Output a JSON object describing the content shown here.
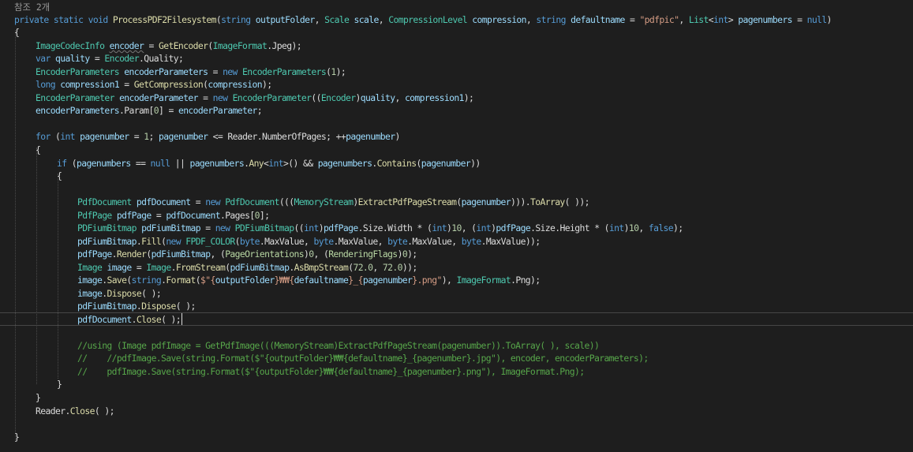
{
  "codelens": "참조 2개",
  "colors": {
    "background": "#1e1e1e",
    "default": "#dcdcdc",
    "keyword": "#569cd6",
    "type": "#4ec9b0",
    "enum": "#b8d7a3",
    "method": "#dcdcaa",
    "parameter": "#9cdcfe",
    "string": "#d69d85",
    "number": "#b5cea8",
    "comment": "#57a64a"
  },
  "lines": [
    [
      [
        "kw",
        "private"
      ],
      [
        "de",
        " "
      ],
      [
        "kw",
        "static"
      ],
      [
        "de",
        " "
      ],
      [
        "kw",
        "void"
      ],
      [
        "de",
        " "
      ],
      [
        "me",
        "ProcessPDF2Filesystem"
      ],
      [
        "de",
        "("
      ],
      [
        "kw",
        "string"
      ],
      [
        "de",
        " "
      ],
      [
        "pa",
        "outputFolder"
      ],
      [
        "de",
        ", "
      ],
      [
        "ty",
        "Scale"
      ],
      [
        "de",
        " "
      ],
      [
        "pa",
        "scale"
      ],
      [
        "de",
        ", "
      ],
      [
        "ty",
        "CompressionLevel"
      ],
      [
        "de",
        " "
      ],
      [
        "pa",
        "compression"
      ],
      [
        "de",
        ", "
      ],
      [
        "kw",
        "string"
      ],
      [
        "de",
        " "
      ],
      [
        "pa",
        "defaultname"
      ],
      [
        "de",
        " = "
      ],
      [
        "st",
        "\"pdfpic\""
      ],
      [
        "de",
        ", "
      ],
      [
        "ty",
        "List"
      ],
      [
        "de",
        "<"
      ],
      [
        "kw",
        "int"
      ],
      [
        "de",
        "> "
      ],
      [
        "pa",
        "pagenumbers"
      ],
      [
        "de",
        " = "
      ],
      [
        "kw",
        "null"
      ],
      [
        "de",
        ")"
      ]
    ],
    [
      [
        "de",
        "{"
      ]
    ],
    [
      [
        "ty",
        "ImageCodecInfo"
      ],
      [
        "de",
        " "
      ],
      [
        "lo",
        "encoder"
      ],
      [
        "de",
        " = "
      ],
      [
        "me",
        "GetEncoder"
      ],
      [
        "de",
        "("
      ],
      [
        "ty",
        "ImageFormat"
      ],
      [
        "de",
        "."
      ],
      [
        "pr",
        "Jpeg"
      ],
      [
        "de",
        ");"
      ]
    ],
    [
      [
        "kw",
        "var"
      ],
      [
        "de",
        " "
      ],
      [
        "lo",
        "quality"
      ],
      [
        "de",
        " = "
      ],
      [
        "ty",
        "Encoder"
      ],
      [
        "de",
        "."
      ],
      [
        "pr",
        "Quality"
      ],
      [
        "de",
        ";"
      ]
    ],
    [
      [
        "ty",
        "EncoderParameters"
      ],
      [
        "de",
        " "
      ],
      [
        "lo",
        "encoderParameters"
      ],
      [
        "de",
        " = "
      ],
      [
        "kw",
        "new"
      ],
      [
        "de",
        " "
      ],
      [
        "ty",
        "EncoderParameters"
      ],
      [
        "de",
        "("
      ],
      [
        "nu",
        "1"
      ],
      [
        "de",
        ");"
      ]
    ],
    [
      [
        "kw",
        "long"
      ],
      [
        "de",
        " "
      ],
      [
        "lo",
        "compression1"
      ],
      [
        "de",
        " = "
      ],
      [
        "me",
        "GetCompression"
      ],
      [
        "de",
        "("
      ],
      [
        "pa",
        "compression"
      ],
      [
        "de",
        ");"
      ]
    ],
    [
      [
        "ty",
        "EncoderParameter"
      ],
      [
        "de",
        " "
      ],
      [
        "lo",
        "encoderParameter"
      ],
      [
        "de",
        " = "
      ],
      [
        "kw",
        "new"
      ],
      [
        "de",
        " "
      ],
      [
        "ty",
        "EncoderParameter"
      ],
      [
        "de",
        "(("
      ],
      [
        "ty",
        "Encoder"
      ],
      [
        "de",
        ")"
      ],
      [
        "lo",
        "quality"
      ],
      [
        "de",
        ", "
      ],
      [
        "lo",
        "compression1"
      ],
      [
        "de",
        ");"
      ]
    ],
    [
      [
        "lo",
        "encoderParameters"
      ],
      [
        "de",
        "."
      ],
      [
        "pr",
        "Param"
      ],
      [
        "de",
        "["
      ],
      [
        "nu",
        "0"
      ],
      [
        "de",
        "] = "
      ],
      [
        "lo",
        "encoderParameter"
      ],
      [
        "de",
        ";"
      ]
    ],
    [
      [
        "kw",
        "for"
      ],
      [
        "de",
        " ("
      ],
      [
        "kw",
        "int"
      ],
      [
        "de",
        " "
      ],
      [
        "lo",
        "pagenumber"
      ],
      [
        "de",
        " = "
      ],
      [
        "nu",
        "1"
      ],
      [
        "de",
        "; "
      ],
      [
        "lo",
        "pagenumber"
      ],
      [
        "de",
        " <= "
      ],
      [
        "pr",
        "Reader"
      ],
      [
        "de",
        "."
      ],
      [
        "pr",
        "NumberOfPages"
      ],
      [
        "de",
        "; ++"
      ],
      [
        "lo",
        "pagenumber"
      ],
      [
        "de",
        ")"
      ]
    ],
    [
      [
        "de",
        "{"
      ]
    ],
    [
      [
        "kw",
        "if"
      ],
      [
        "de",
        " ("
      ],
      [
        "pa",
        "pagenumbers"
      ],
      [
        "de",
        " == "
      ],
      [
        "kw",
        "null"
      ],
      [
        "de",
        " || "
      ],
      [
        "pa",
        "pagenumbers"
      ],
      [
        "de",
        "."
      ],
      [
        "me",
        "Any"
      ],
      [
        "de",
        "<"
      ],
      [
        "kw",
        "int"
      ],
      [
        "de",
        ">() && "
      ],
      [
        "pa",
        "pagenumbers"
      ],
      [
        "de",
        "."
      ],
      [
        "me",
        "Contains"
      ],
      [
        "de",
        "("
      ],
      [
        "lo",
        "pagenumber"
      ],
      [
        "de",
        "))"
      ]
    ],
    [
      [
        "de",
        "{"
      ]
    ],
    [
      [
        "ty",
        "PdfDocument"
      ],
      [
        "de",
        " "
      ],
      [
        "lo",
        "pdfDocument"
      ],
      [
        "de",
        " = "
      ],
      [
        "kw",
        "new"
      ],
      [
        "de",
        " "
      ],
      [
        "ty",
        "PdfDocument"
      ],
      [
        "de",
        "((("
      ],
      [
        "ty",
        "MemoryStream"
      ],
      [
        "de",
        ")"
      ],
      [
        "me",
        "ExtractPdfPageStream"
      ],
      [
        "de",
        "("
      ],
      [
        "lo",
        "pagenumber"
      ],
      [
        "de",
        ")))."
      ],
      [
        "me",
        "ToArray"
      ],
      [
        "de",
        "( ));"
      ]
    ],
    [
      [
        "ty",
        "PdfPage"
      ],
      [
        "de",
        " "
      ],
      [
        "lo",
        "pdfPage"
      ],
      [
        "de",
        " = "
      ],
      [
        "lo",
        "pdfDocument"
      ],
      [
        "de",
        "."
      ],
      [
        "pr",
        "Pages"
      ],
      [
        "de",
        "["
      ],
      [
        "nu",
        "0"
      ],
      [
        "de",
        "];"
      ]
    ],
    [
      [
        "ty",
        "PDFiumBitmap"
      ],
      [
        "de",
        " "
      ],
      [
        "lo",
        "pdFiumBitmap"
      ],
      [
        "de",
        " = "
      ],
      [
        "kw",
        "new"
      ],
      [
        "de",
        " "
      ],
      [
        "ty",
        "PDFiumBitmap"
      ],
      [
        "de",
        "(("
      ],
      [
        "kw",
        "int"
      ],
      [
        "de",
        ")"
      ],
      [
        "lo",
        "pdfPage"
      ],
      [
        "de",
        "."
      ],
      [
        "pr",
        "Size"
      ],
      [
        "de",
        "."
      ],
      [
        "pr",
        "Width"
      ],
      [
        "de",
        " * ("
      ],
      [
        "kw",
        "int"
      ],
      [
        "de",
        ")"
      ],
      [
        "nu",
        "10"
      ],
      [
        "de",
        ", ("
      ],
      [
        "kw",
        "int"
      ],
      [
        "de",
        ")"
      ],
      [
        "lo",
        "pdfPage"
      ],
      [
        "de",
        "."
      ],
      [
        "pr",
        "Size"
      ],
      [
        "de",
        "."
      ],
      [
        "pr",
        "Height"
      ],
      [
        "de",
        " * ("
      ],
      [
        "kw",
        "int"
      ],
      [
        "de",
        ")"
      ],
      [
        "nu",
        "10"
      ],
      [
        "de",
        ", "
      ],
      [
        "kw",
        "false"
      ],
      [
        "de",
        ");"
      ]
    ],
    [
      [
        "lo",
        "pdFiumBitmap"
      ],
      [
        "de",
        "."
      ],
      [
        "me",
        "Fill"
      ],
      [
        "de",
        "("
      ],
      [
        "kw",
        "new"
      ],
      [
        "de",
        " "
      ],
      [
        "ty",
        "FPDF_COLOR"
      ],
      [
        "de",
        "("
      ],
      [
        "kw",
        "byte"
      ],
      [
        "de",
        "."
      ],
      [
        "pr",
        "MaxValue"
      ],
      [
        "de",
        ", "
      ],
      [
        "kw",
        "byte"
      ],
      [
        "de",
        "."
      ],
      [
        "pr",
        "MaxValue"
      ],
      [
        "de",
        ", "
      ],
      [
        "kw",
        "byte"
      ],
      [
        "de",
        "."
      ],
      [
        "pr",
        "MaxValue"
      ],
      [
        "de",
        ", "
      ],
      [
        "kw",
        "byte"
      ],
      [
        "de",
        "."
      ],
      [
        "pr",
        "MaxValue"
      ],
      [
        "de",
        "));"
      ]
    ],
    [
      [
        "lo",
        "pdfPage"
      ],
      [
        "de",
        "."
      ],
      [
        "me",
        "Render"
      ],
      [
        "de",
        "("
      ],
      [
        "lo",
        "pdFiumBitmap"
      ],
      [
        "de",
        ", ("
      ],
      [
        "en",
        "PageOrientations"
      ],
      [
        "de",
        ")"
      ],
      [
        "nu",
        "0"
      ],
      [
        "de",
        ", ("
      ],
      [
        "en",
        "RenderingFlags"
      ],
      [
        "de",
        ")"
      ],
      [
        "nu",
        "0"
      ],
      [
        "de",
        ");"
      ]
    ],
    [
      [
        "ty",
        "Image"
      ],
      [
        "de",
        " "
      ],
      [
        "lo",
        "image"
      ],
      [
        "de",
        " = "
      ],
      [
        "ty",
        "Image"
      ],
      [
        "de",
        "."
      ],
      [
        "me",
        "FromStream"
      ],
      [
        "de",
        "("
      ],
      [
        "lo",
        "pdFiumBitmap"
      ],
      [
        "de",
        "."
      ],
      [
        "me",
        "AsBmpStream"
      ],
      [
        "de",
        "("
      ],
      [
        "nu",
        "72.0"
      ],
      [
        "de",
        ", "
      ],
      [
        "nu",
        "72.0"
      ],
      [
        "de",
        "));"
      ]
    ],
    [
      [
        "lo",
        "image"
      ],
      [
        "de",
        "."
      ],
      [
        "me",
        "Save"
      ],
      [
        "de",
        "("
      ],
      [
        "kw",
        "string"
      ],
      [
        "de",
        "."
      ],
      [
        "me",
        "Format"
      ],
      [
        "de",
        "("
      ],
      [
        "st",
        "$\"{"
      ],
      [
        "pa",
        "outputFolder"
      ],
      [
        "st",
        "}₩₩{"
      ],
      [
        "pa",
        "defaultname"
      ],
      [
        "st",
        "}_{"
      ],
      [
        "lo",
        "pagenumber"
      ],
      [
        "st",
        "}.png\""
      ],
      [
        "de",
        "), "
      ],
      [
        "ty",
        "ImageFormat"
      ],
      [
        "de",
        "."
      ],
      [
        "pr",
        "Png"
      ],
      [
        "de",
        ");"
      ]
    ],
    [
      [
        "lo",
        "image"
      ],
      [
        "de",
        "."
      ],
      [
        "me",
        "Dispose"
      ],
      [
        "de",
        "( );"
      ]
    ],
    [
      [
        "lo",
        "pdFiumBitmap"
      ],
      [
        "de",
        "."
      ],
      [
        "me",
        "Dispose"
      ],
      [
        "de",
        "( );"
      ]
    ],
    [
      [
        "lo",
        "pdfDocument"
      ],
      [
        "de",
        "."
      ],
      [
        "me",
        "Close"
      ],
      [
        "de",
        "( );"
      ]
    ],
    [
      [
        "cm",
        "//using (Image pdfImage = GetPdfImage(((MemoryStream)ExtractPdfPageStream(pagenumber)).ToArray( ), scale))"
      ]
    ],
    [
      [
        "cm",
        "//    //pdfImage.Save(string.Format($\"{outputFolder}₩₩{defaultname}_{pagenumber}.jpg\"), encoder, encoderParameters);"
      ]
    ],
    [
      [
        "cm",
        "//    pdfImage.Save(string.Format($\"{outputFolder}₩₩{defaultname}_{pagenumber}.png\"), ImageFormat.Png);"
      ]
    ],
    [
      [
        "de",
        "}"
      ]
    ],
    [
      [
        "de",
        "}"
      ]
    ],
    [
      [
        "pr",
        "Reader"
      ],
      [
        "de",
        "."
      ],
      [
        "me",
        "Close"
      ],
      [
        "de",
        "( );"
      ]
    ],
    [
      [
        "de",
        "}"
      ]
    ]
  ]
}
